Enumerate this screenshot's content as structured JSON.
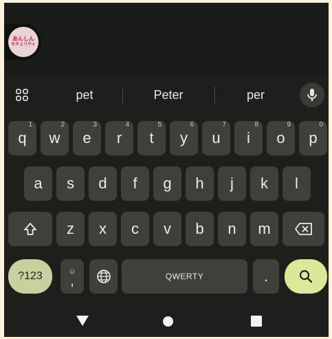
{
  "app_badge": {
    "line1": "あんしん",
    "line2": "セキュリティ"
  },
  "suggestions": [
    "pet",
    "Peter",
    "per"
  ],
  "rows": {
    "row1": [
      {
        "label": "q",
        "hint": "1"
      },
      {
        "label": "w",
        "hint": "2"
      },
      {
        "label": "e",
        "hint": "3"
      },
      {
        "label": "r",
        "hint": "4"
      },
      {
        "label": "t",
        "hint": "5"
      },
      {
        "label": "y",
        "hint": "6"
      },
      {
        "label": "u",
        "hint": "7"
      },
      {
        "label": "i",
        "hint": "8"
      },
      {
        "label": "o",
        "hint": "9"
      },
      {
        "label": "p",
        "hint": "0"
      }
    ],
    "row2": [
      "a",
      "s",
      "d",
      "f",
      "g",
      "h",
      "j",
      "k",
      "l"
    ],
    "row3": [
      "z",
      "x",
      "c",
      "v",
      "b",
      "n",
      "m"
    ]
  },
  "bottom_row": {
    "symbols_label": "?123",
    "emoji_face": "☺",
    "comma_label": ",",
    "space_label": "QWERTY",
    "period_label": "."
  },
  "colors": {
    "keyboard_bg": "#1e1f1d",
    "key_bg": "#3f403c",
    "symbols_key": "#c9cf9e",
    "search_key": "#dde79a",
    "page_bg": "#fdf1de"
  },
  "icons": {
    "apps": "grid-icon",
    "voice": "mic-icon",
    "shift": "shift-icon",
    "delete": "backspace-icon",
    "language": "globe-icon",
    "action": "search-icon",
    "nav_back": "back-triangle-icon",
    "nav_home": "home-circle-icon",
    "nav_recents": "recents-square-icon"
  }
}
